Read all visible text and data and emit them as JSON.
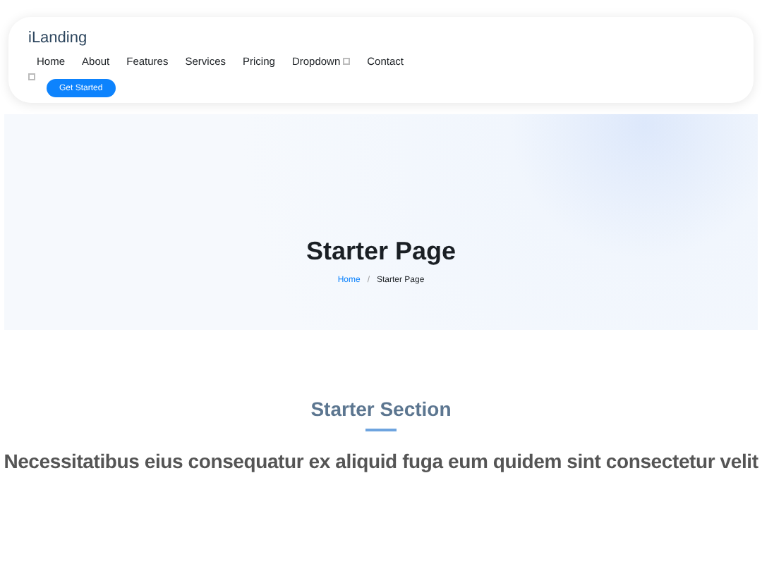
{
  "header": {
    "logo": "iLanding",
    "nav": [
      {
        "label": "Home",
        "selected": false
      },
      {
        "label": "About",
        "selected": false
      },
      {
        "label": "Features",
        "selected": false
      },
      {
        "label": "Services",
        "selected": false
      },
      {
        "label": "Pricing",
        "selected": false
      },
      {
        "label": "Dropdown",
        "selected": false,
        "kind": "dropdown"
      },
      {
        "label": "Contact",
        "selected": false
      }
    ],
    "cta": "Get Started"
  },
  "hero": {
    "title": "Starter Page",
    "breadcrumbs": [
      "Home",
      "Starter Page"
    ],
    "separator": "/"
  },
  "section": {
    "title": "Starter Section",
    "text": "Necessitatibus eius consequatur ex aliquid fuga eum quidem sint consectetur velit"
  }
}
